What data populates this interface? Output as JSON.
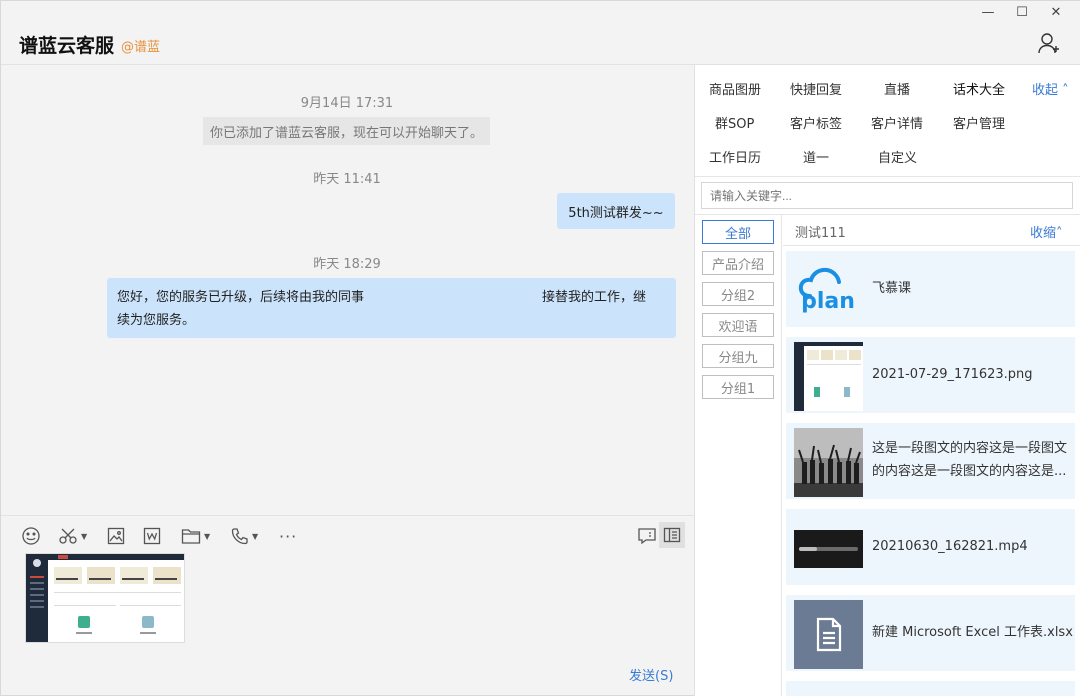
{
  "window": {
    "controls": {
      "minimize": "—",
      "maximize": "☐",
      "close": "✕"
    }
  },
  "header": {
    "title": "谱蓝云客服",
    "tag": "@谱蓝"
  },
  "chat": {
    "messages": [
      {
        "time": "9月14日 17:31",
        "system_text": "你已添加了谱蓝云客服，现在可以开始聊天了。"
      },
      {
        "time": "昨天 11:41",
        "text": "5th测试群发~~"
      },
      {
        "time": "昨天 18:29",
        "text_part1": "您好，您的服务已升级，后续将由我的同事",
        "text_part2": "接替我的工作，继",
        "text_part3": "续为您服务。"
      }
    ]
  },
  "compose": {
    "send_label": "发送(S)",
    "more_label": "···"
  },
  "right_panel": {
    "tabs_row1": [
      "商品图册",
      "快捷回复",
      "直播",
      "话术大全"
    ],
    "tabs_row2": [
      "群SOP",
      "客户标签",
      "客户详情",
      "客户管理"
    ],
    "tabs_row3": [
      "工作日历",
      "道一",
      "自定义"
    ],
    "collapse_label": "收起 ˄",
    "search_placeholder": "请输入关键字...",
    "categories": [
      "全部",
      "产品介绍",
      "分组2",
      "欢迎语",
      "分组九",
      "分组1"
    ],
    "group_title": "测试111",
    "group_collapse": "收缩˄",
    "items": [
      {
        "title": "飞慕课"
      },
      {
        "title": "2021-07-29_171623.png"
      },
      {
        "title_line1": "这是一段图文的内容这是一段图文",
        "title_line2": "的内容这是一段图文的内容这是..."
      },
      {
        "title": "20210630_162821.mp4"
      },
      {
        "title": "新建 Microsoft Excel 工作表.xlsx"
      }
    ]
  },
  "colors": {
    "accent": "#3a7bd5",
    "bubble": "#cce4fb",
    "tag": "#e8913a",
    "card_bg": "#eef6fd"
  }
}
